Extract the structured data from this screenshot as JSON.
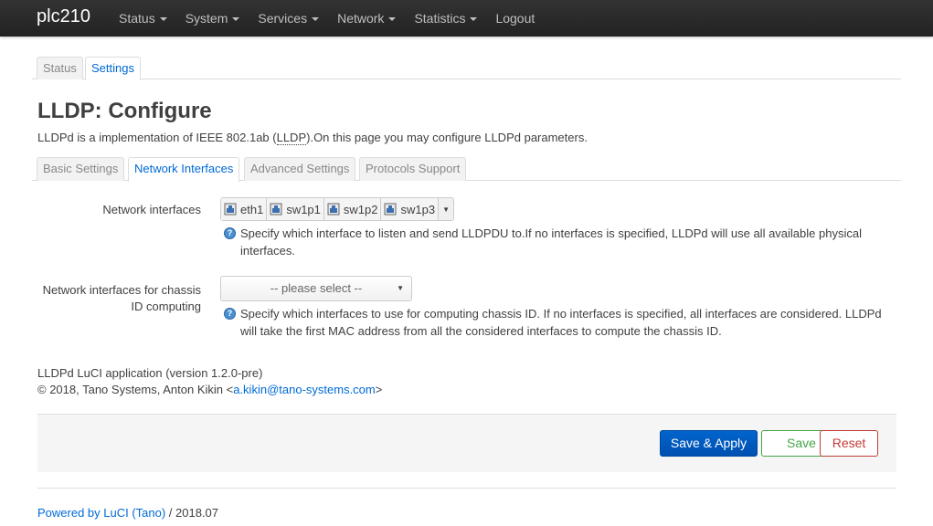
{
  "navbar": {
    "brand": "plc210",
    "menu": [
      "Status",
      "System",
      "Services",
      "Network",
      "Statistics",
      "Logout"
    ]
  },
  "top_tabs": [
    "Status",
    "Settings"
  ],
  "page": {
    "title": "LLDP: Configure",
    "desc_pre": "LLDPd is a implementation of IEEE 802.1ab (",
    "desc_abbr": "LLDP",
    "desc_post": ").On this page you may configure LLDPd parameters."
  },
  "section_tabs": [
    "Basic Settings",
    "Network Interfaces",
    "Advanced Settings",
    "Protocols Support"
  ],
  "fields": {
    "interfaces": {
      "label": "Network interfaces",
      "selected": [
        "eth1",
        "sw1p1",
        "sw1p2",
        "sw1p3"
      ],
      "help": "Specify which interface to listen and send LLDPDU to.If no interfaces is specified, LLDPd will use all available physical interfaces."
    },
    "chassis": {
      "label_line1": "Network interfaces for chassis",
      "label_line2": "ID computing",
      "placeholder": "-- please select --",
      "help": "Specify which interfaces to use for computing chassis ID. If no interfaces is specified, all interfaces are considered. LLDPd will take the first MAC address from all the considered interfaces to compute the chassis ID."
    }
  },
  "app_info": {
    "version_line": "LLDPd LuCI application (version 1.2.0-pre)",
    "copyright_pre": "© 2018, Tano Systems, Anton Kikin <",
    "email": "a.kikin@tano-systems.com",
    "copyright_post": ">"
  },
  "actions": {
    "save_apply": "Save & Apply",
    "save": "Save",
    "reset": "Reset"
  },
  "footer": {
    "powered_link": "Powered by LuCI (Tano)",
    "version": " / 2018.07"
  },
  "colors": {
    "navbar": "#222222",
    "link": "#0069d6",
    "primary": "#0064cd",
    "save": "#46a546",
    "reset": "#c43c35"
  }
}
